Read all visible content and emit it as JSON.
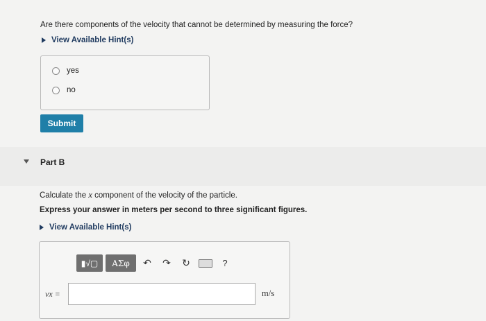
{
  "partA": {
    "question": "Are there components of the velocity that cannot be determined by measuring the force?",
    "hint_label": "View Available Hint(s)",
    "choices": [
      "yes",
      "no"
    ],
    "submit_label": "Submit"
  },
  "partB": {
    "title": "Part B",
    "calc_prefix": "Calculate the ",
    "calc_var": "x",
    "calc_suffix": " component of the velocity of the particle.",
    "express": "Express your answer in meters per second to three significant figures.",
    "hint_label": "View Available Hint(s)",
    "toolbar": {
      "templates": "▮√▢",
      "symbols": "ΑΣφ",
      "undo": "↶",
      "redo": "↷",
      "reset": "↻",
      "help": "?"
    },
    "answer": {
      "label": "vx =",
      "value": "",
      "unit": "m/s"
    }
  },
  "icons": {
    "expand": "triangle-right-icon",
    "collapse": "triangle-down-icon"
  }
}
